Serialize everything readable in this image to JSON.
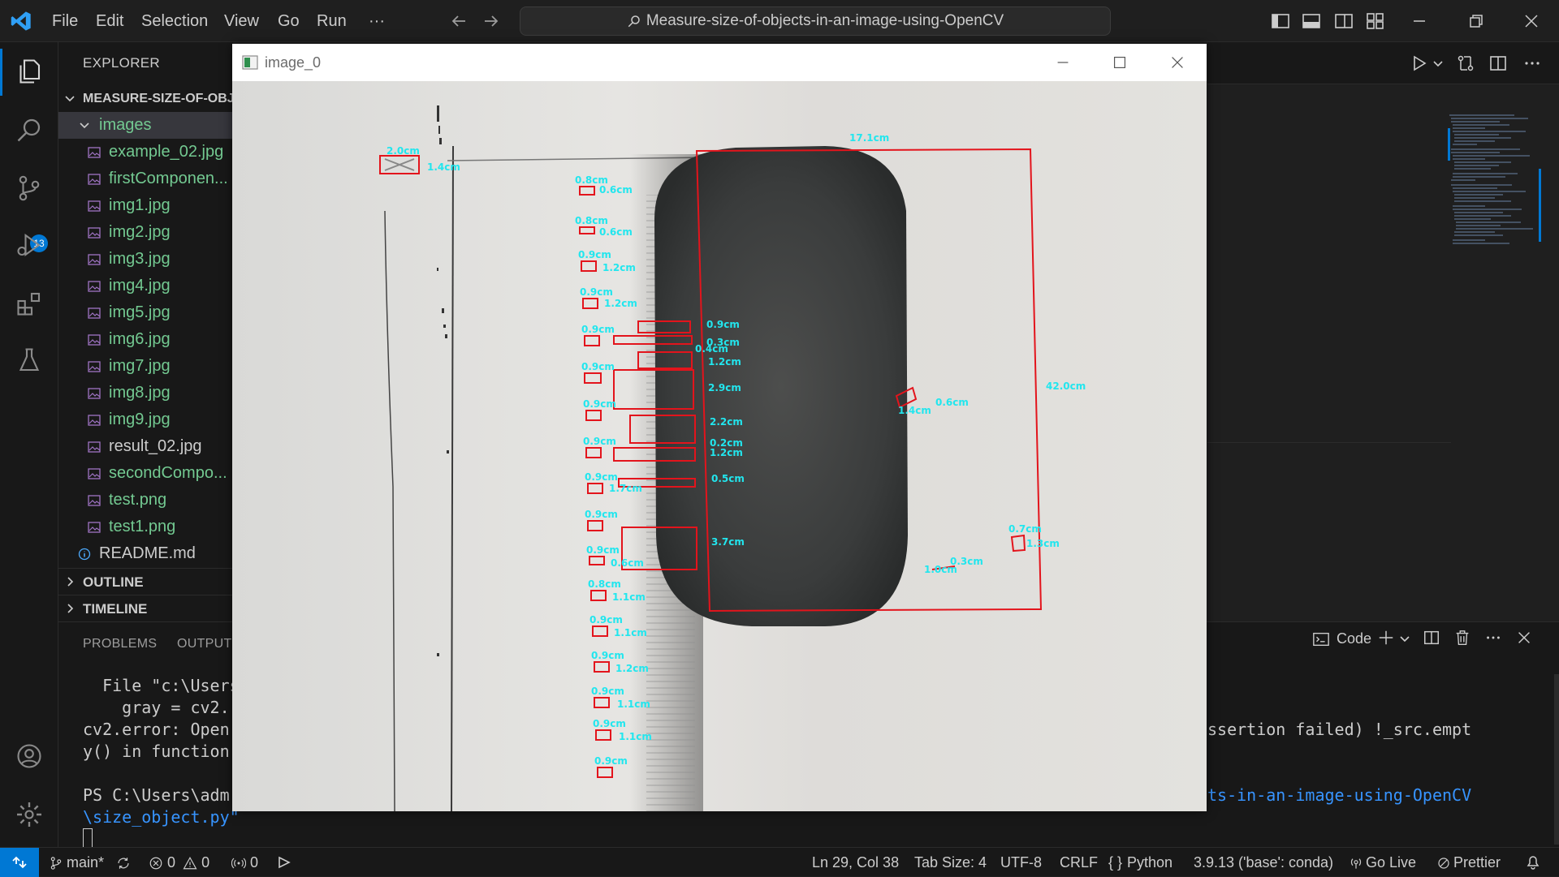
{
  "titlebar": {
    "menu": [
      "File",
      "Edit",
      "Selection",
      "View",
      "Go",
      "Run",
      "···"
    ],
    "search_text": "Measure-size-of-objects-in-an-image-using-OpenCV",
    "window_controls": [
      "minimize-icon",
      "restore-icon",
      "close-icon"
    ]
  },
  "activity_bar": {
    "items": [
      "files-icon",
      "search-icon",
      "source-control-icon",
      "run-debug-icon",
      "extensions-icon",
      "testing-icon"
    ],
    "source_control_badge": "13",
    "bottom": [
      "account-icon",
      "settings-gear-icon"
    ]
  },
  "sidebar": {
    "title": "EXPLORER",
    "root_folder": "MEASURE-SIZE-OF-OBJ...",
    "images_folder": "images",
    "files": [
      "example_02.jpg",
      "firstComponen...",
      "img1.jpg",
      "img2.jpg",
      "img3.jpg",
      "img4.jpg",
      "img5.jpg",
      "img6.jpg",
      "img7.jpg",
      "img8.jpg",
      "img9.jpg",
      "result_02.jpg",
      "secondCompo...",
      "test.png",
      "test1.png"
    ],
    "readme": "README.md",
    "outline": "OUTLINE",
    "timeline": "TIMELINE"
  },
  "image_window": {
    "title": "image_0",
    "measurements": {
      "object_width": "17.1cm",
      "object_height": "42.0cm",
      "inner_a": "1.4cm",
      "inner_b": "0.6cm",
      "spot_a": "0.7cm",
      "spot_b": "1.3cm",
      "spot_c": "0.3cm",
      "spot_d": "1.0cm",
      "scale_top_a": "2.0cm",
      "scale_top_b": "1.4cm",
      "tick_labels": [
        "0.8cm",
        "0.6cm",
        "0.8cm",
        "0.6cm",
        "0.9cm",
        "1.2cm",
        "0.9cm",
        "1.2cm",
        "0.9cm",
        "0.9cm",
        "0.9cm",
        "0.9cm",
        "0.9cm",
        "1.7cm",
        "0.9cm",
        "0.9cm",
        "0.6cm",
        "0.8cm",
        "1.1cm",
        "0.9cm",
        "1.1cm",
        "0.9cm",
        "1.2cm",
        "0.9cm",
        "1.1cm",
        "0.9cm",
        "1.1cm",
        "0.9cm"
      ],
      "right_col": [
        "0.9cm",
        "0.3cm",
        "0.4cm",
        "1.2cm",
        "2.9cm",
        "2.2cm",
        "0.2cm",
        "1.2cm",
        "0.5cm",
        "3.7cm"
      ]
    }
  },
  "editor_actions": [
    "run-icon",
    "chevron-down-icon",
    "compare-icon",
    "split-editor-icon",
    "more-icon"
  ],
  "panel": {
    "tabs": [
      "PROBLEMS",
      "OUTPUT"
    ],
    "terminal_lines": [
      "  File \"c:\\Users",
      "    gray = cv2.",
      "cv2.error: Open",
      "y() in function",
      "",
      "PS C:\\Users\\adm",
      "\\size_object.py\""
    ],
    "terminal_right_1": "ssertion failed) !_src.empt",
    "terminal_right_2": "ts-in-an-image-using-OpenCV",
    "terminal_label": "Code",
    "actions": [
      "terminal-icon",
      "add-icon",
      "chevron-down-icon",
      "split-icon",
      "trash-icon",
      "more-icon",
      "close-icon"
    ]
  },
  "status_bar": {
    "branch": "main*",
    "errors": "0",
    "warnings": "0",
    "ports": "0",
    "position": "Ln 29, Col 38",
    "tab_size": "Tab Size: 4",
    "encoding": "UTF-8",
    "eol": "CRLF",
    "language": "Python",
    "interpreter": "3.9.13 ('base': conda)",
    "go_live": "Go Live",
    "prettier": "Prettier"
  },
  "colors": {
    "accent": "#0078d4",
    "measure_label": "#22e6ee",
    "measure_box": "#e3141c",
    "file_green": "#73c991"
  }
}
